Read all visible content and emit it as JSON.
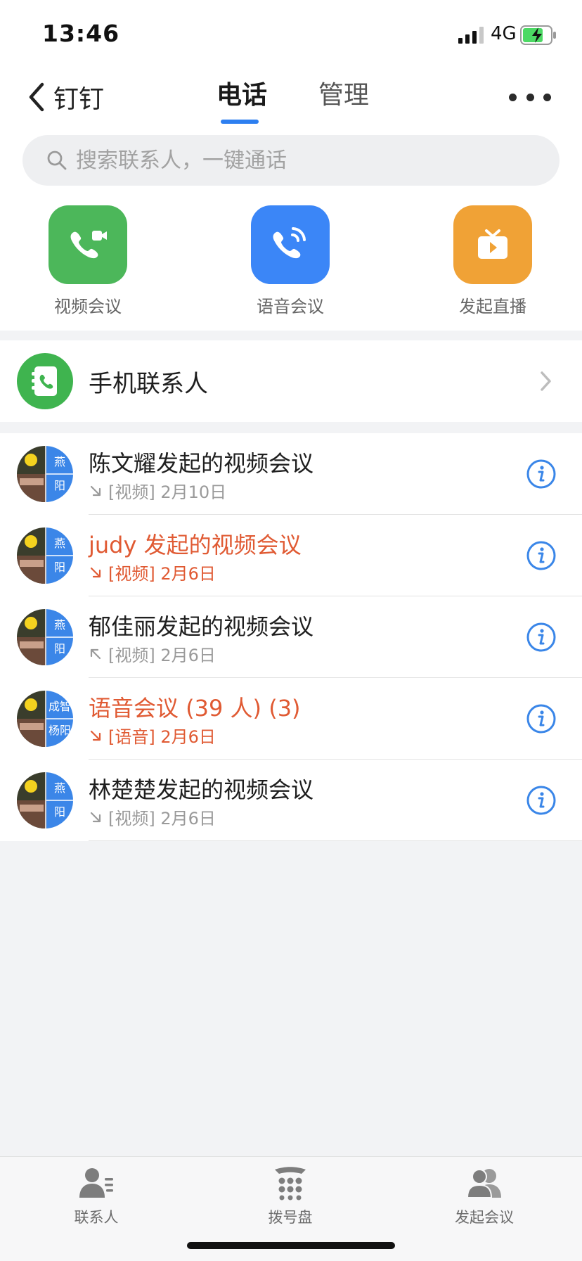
{
  "status": {
    "time": "13:46",
    "network": "4G"
  },
  "nav": {
    "back_label": "钉钉",
    "tabs": [
      "电话",
      "管理"
    ]
  },
  "search": {
    "placeholder": "搜索联系人，一键通话"
  },
  "quick_actions": [
    {
      "label": "视频会议",
      "color": "#4cb75a",
      "icon": "video-call-icon"
    },
    {
      "label": "语音会议",
      "color": "#3b86f7",
      "icon": "voice-call-icon"
    },
    {
      "label": "发起直播",
      "color": "#f0a236",
      "icon": "live-tv-icon"
    }
  ],
  "phone_contacts": {
    "label": "手机联系人"
  },
  "calls": [
    {
      "title": "陈文耀发起的视频会议",
      "type": "[视频]",
      "date": "2月10日",
      "missed": false,
      "direction": "in",
      "avatar_text": [
        "燕",
        "阳"
      ]
    },
    {
      "title": "judy 发起的视频会议",
      "type": "[视频]",
      "date": "2月6日",
      "missed": true,
      "direction": "in",
      "avatar_text": [
        "燕",
        "阳"
      ]
    },
    {
      "title": "郁佳丽发起的视频会议",
      "type": "[视频]",
      "date": "2月6日",
      "missed": false,
      "direction": "out",
      "avatar_text": [
        "燕",
        "阳"
      ]
    },
    {
      "title": "语音会议 (39 人) (3)",
      "type": "[语音]",
      "date": "2月6日",
      "missed": true,
      "direction": "in",
      "avatar_text": [
        "成智",
        "杨阳"
      ]
    },
    {
      "title": "林楚楚发起的视频会议",
      "type": "[视频]",
      "date": "2月6日",
      "missed": false,
      "direction": "in",
      "avatar_text": [
        "燕",
        "阳"
      ]
    }
  ],
  "tabbar": [
    {
      "label": "联系人",
      "icon": "contacts-icon"
    },
    {
      "label": "拨号盘",
      "icon": "dialpad-icon"
    },
    {
      "label": "发起会议",
      "icon": "start-meeting-icon"
    }
  ],
  "colors": {
    "accent": "#2d7ff0",
    "missed": "#e05a33",
    "info": "#3a86e8"
  }
}
